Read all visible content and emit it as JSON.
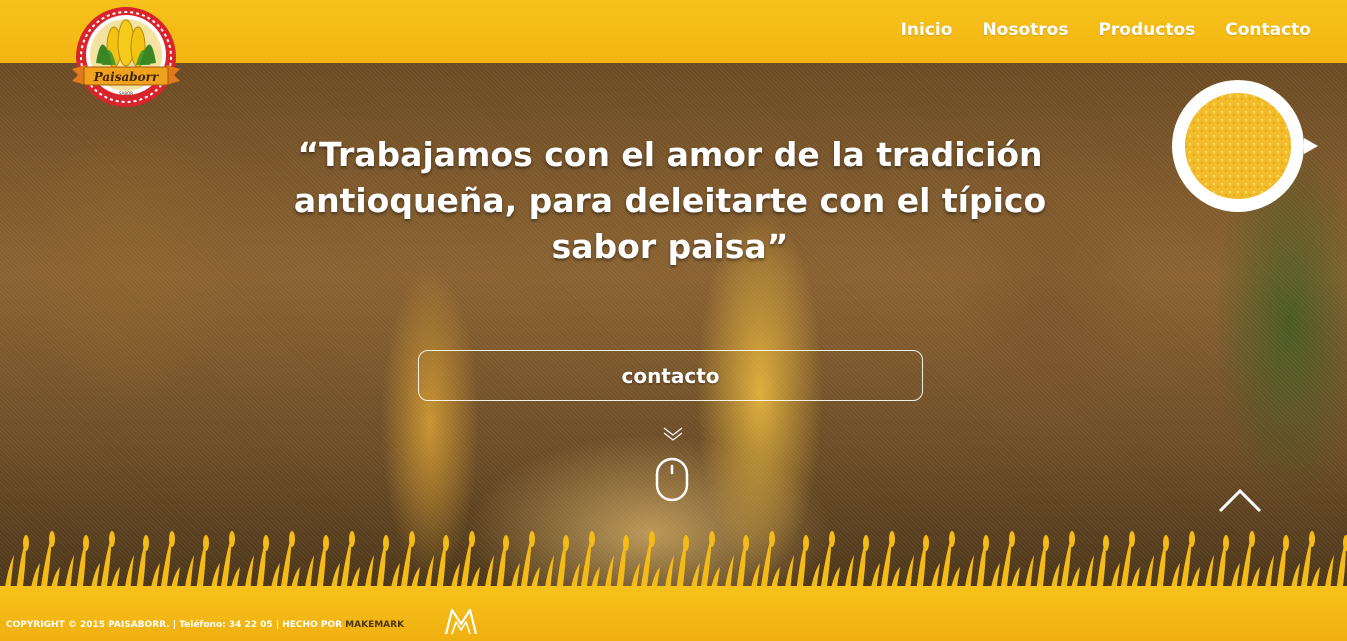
{
  "logo": {
    "name": "Paisaborr",
    "subtitle": "SABOR"
  },
  "nav": {
    "items": [
      "Inicio",
      "Nosotros",
      "Productos",
      "Contacto"
    ]
  },
  "hero": {
    "quote_line1": "“Trabajamos con el amor de la tradición",
    "quote_line2": "antioqueña, para deleitarte con el típico",
    "quote_line3": "sabor paisa”",
    "cta_label": "contacto"
  },
  "footer": {
    "text": "COPYRIGHT © 2015 PAISABORR. | Teléfono: 34 22 05 | HECHO POR ",
    "maker": "MAKEMARK"
  },
  "colors": {
    "brand_yellow": "#f5bb16",
    "logo_red": "#d8242a",
    "white": "#ffffff"
  },
  "icons": [
    "corn-logo-icon",
    "chevron-down-icon",
    "mouse-scroll-icon",
    "chevron-up-icon",
    "makemark-logo-icon"
  ]
}
